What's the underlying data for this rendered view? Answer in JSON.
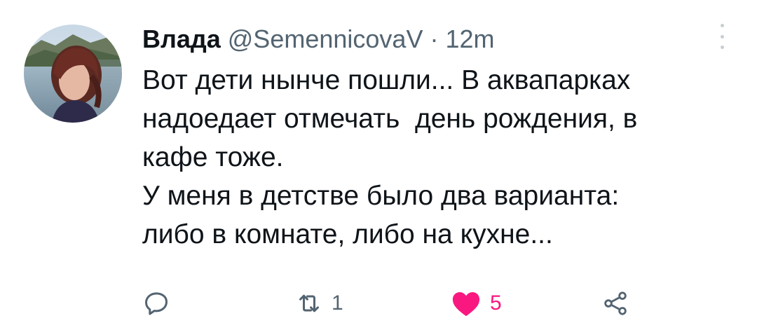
{
  "tweet": {
    "author": {
      "display_name": "Влада",
      "handle": "@SemennicovaV",
      "separator": "·",
      "time": "12m"
    },
    "text_lines": [
      "Вот дети нынче пошли... В аквапарках",
      "надоедает отмечать  день рождения, в",
      "кафе тоже.",
      "У меня в детстве было два варианта:",
      "либо в комнате, либо на кухне..."
    ],
    "actions": {
      "reply": {
        "icon": "reply-icon",
        "count": ""
      },
      "retweet": {
        "icon": "retweet-icon",
        "count": "1"
      },
      "like": {
        "icon": "heart-filled-icon",
        "count": "5",
        "color": "#f91880"
      },
      "share": {
        "icon": "share-icon"
      }
    },
    "more_icon": "more-vertical-icon"
  },
  "colors": {
    "text": "#0f1419",
    "secondary": "#536471",
    "like": "#f91880",
    "background": "#ffffff"
  }
}
